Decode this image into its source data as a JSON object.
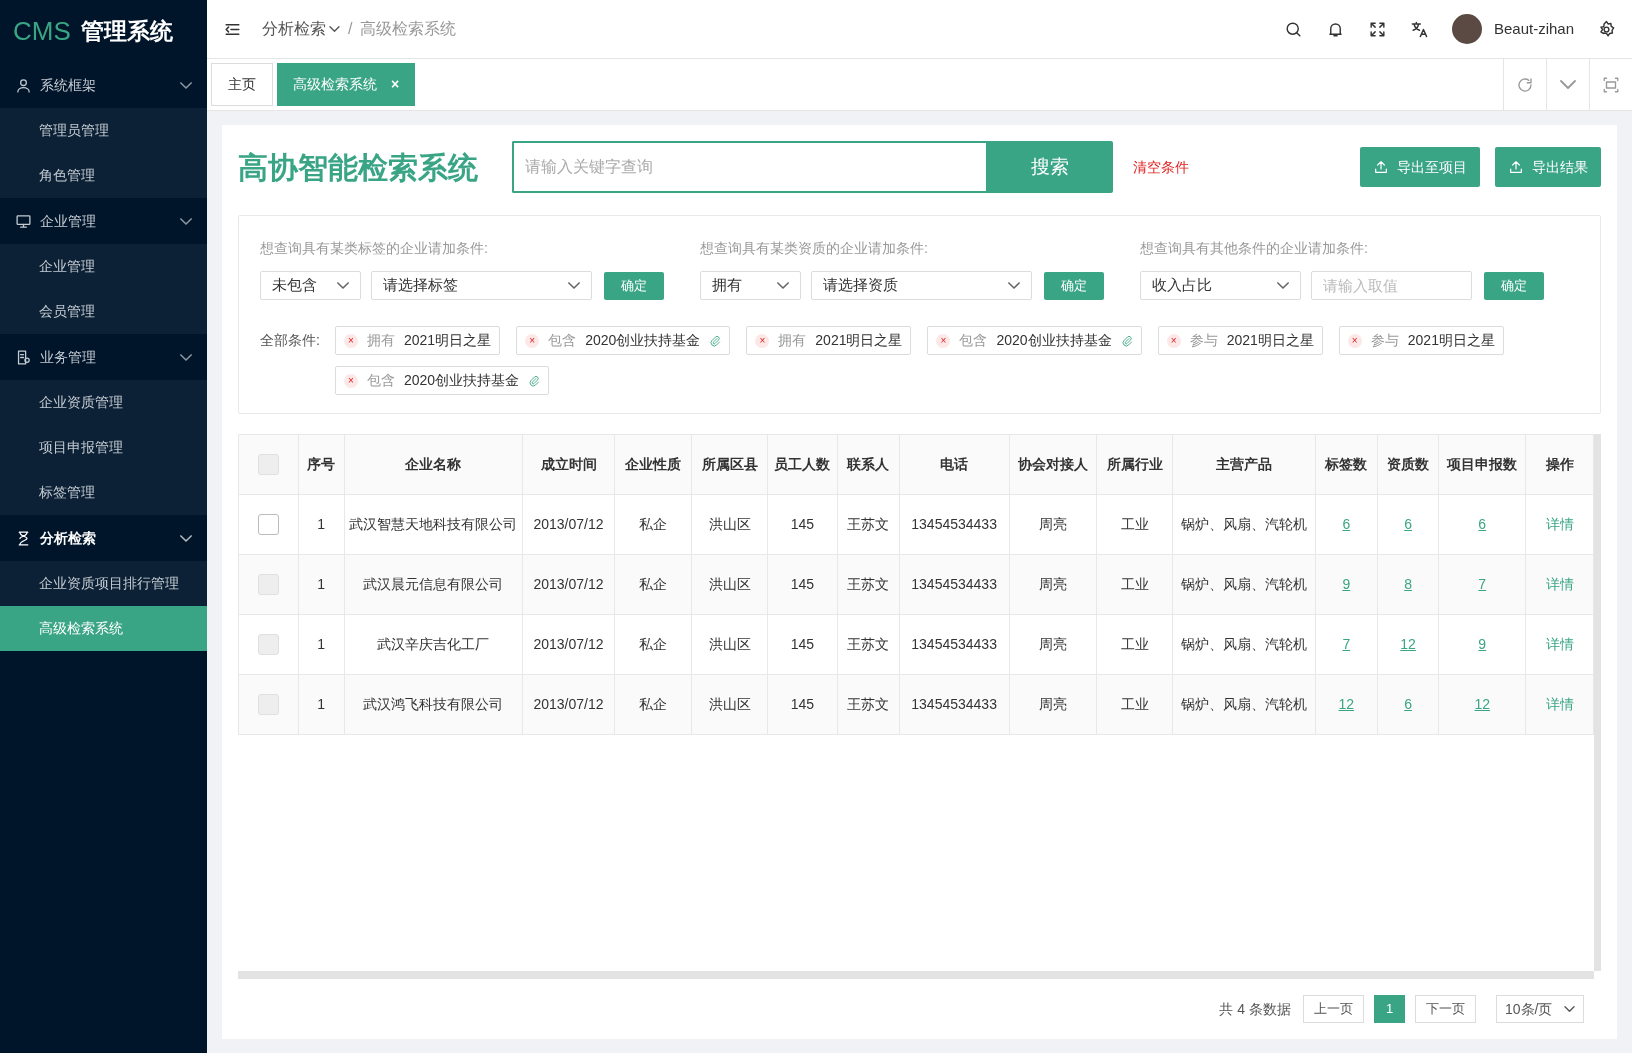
{
  "sidebar": {
    "logo_brand": "CMS",
    "logo_title": "管理系统",
    "groups": [
      {
        "label": "系统框架",
        "active": false,
        "items": [
          {
            "label": "管理员管理",
            "selected": false
          },
          {
            "label": "角色管理",
            "selected": false
          }
        ]
      },
      {
        "label": "企业管理",
        "active": false,
        "items": [
          {
            "label": "企业管理",
            "selected": false
          },
          {
            "label": "会员管理",
            "selected": false
          }
        ]
      },
      {
        "label": "业务管理",
        "active": false,
        "items": [
          {
            "label": "企业资质管理",
            "selected": false
          },
          {
            "label": "项目申报管理",
            "selected": false
          },
          {
            "label": "标签管理",
            "selected": false
          }
        ]
      },
      {
        "label": "分析检索",
        "active": true,
        "items": [
          {
            "label": "企业资质项目排行管理",
            "selected": false
          },
          {
            "label": "高级检索系统",
            "selected": true
          }
        ]
      }
    ]
  },
  "header": {
    "breadcrumb": [
      "分析检索",
      "高级检索系统"
    ],
    "separator": "/",
    "user": "Beaut-zihan"
  },
  "tabs": [
    {
      "label": "主页",
      "selected": false
    },
    {
      "label": "高级检索系统",
      "selected": true,
      "close": "×"
    }
  ],
  "search": {
    "title": "高协智能检索系统",
    "placeholder": "请输入关键字查询",
    "button": "搜索",
    "clear": "清空条件",
    "export_project": "导出至项目",
    "export_result": "导出结果"
  },
  "filters": [
    {
      "label": "想查询具有某类标签的企业请加条件:",
      "select1": "未包含",
      "select2": "请选择标签",
      "kind": "select",
      "button": "确定"
    },
    {
      "label": "想查询具有某类资质的企业请加条件:",
      "select1": "拥有",
      "select2": "请选择资质",
      "kind": "select",
      "button": "确定"
    },
    {
      "label": "想查询具有其他条件的企业请加条件:",
      "select1": "收入占比",
      "placeholder": "请输入取值",
      "kind": "input",
      "button": "确定"
    }
  ],
  "conditions_label": "全部条件:",
  "conditions": [
    {
      "remove": "×",
      "verb": "拥有",
      "value": "2021明日之星",
      "attachment": false
    },
    {
      "remove": "×",
      "verb": "包含",
      "value": "2020创业扶持基金",
      "attachment": true
    },
    {
      "remove": "×",
      "verb": "拥有",
      "value": "2021明日之星",
      "attachment": false
    },
    {
      "remove": "×",
      "verb": "包含",
      "value": "2020创业扶持基金",
      "attachment": true
    },
    {
      "remove": "×",
      "verb": "参与",
      "value": "2021明日之星",
      "attachment": false
    },
    {
      "remove": "×",
      "verb": "参与",
      "value": "2021明日之星",
      "attachment": false
    },
    {
      "remove": "×",
      "verb": "包含",
      "value": "2020创业扶持基金",
      "attachment": true
    }
  ],
  "table": {
    "select_all_disabled": true,
    "columns": [
      "序号",
      "企业名称",
      "成立时间",
      "企业性质",
      "所属区县",
      "员工人数",
      "联系人",
      "电话",
      "协会对接人",
      "所属行业",
      "主营产品",
      "标签数",
      "资质数",
      "项目申报数",
      "操作"
    ],
    "rows": [
      {
        "disabled": false,
        "cells": [
          "1",
          "武汉智慧天地科技有限公司",
          "2013/07/12",
          "私企",
          "洪山区",
          "145",
          "王苏文",
          "13454534433",
          "周亮",
          "工业",
          "锅炉、风扇、汽轮机",
          "6",
          "6",
          "6",
          "详情"
        ]
      },
      {
        "disabled": true,
        "cells": [
          "1",
          "武汉晨元信息有限公司",
          "2013/07/12",
          "私企",
          "洪山区",
          "145",
          "王苏文",
          "13454534433",
          "周亮",
          "工业",
          "锅炉、风扇、汽轮机",
          "9",
          "8",
          "7",
          "详情"
        ]
      },
      {
        "disabled": true,
        "cells": [
          "1",
          "武汉辛庆吉化工厂",
          "2013/07/12",
          "私企",
          "洪山区",
          "145",
          "王苏文",
          "13454534433",
          "周亮",
          "工业",
          "锅炉、风扇、汽轮机",
          "7",
          "12",
          "9",
          "详情"
        ]
      },
      {
        "disabled": true,
        "cells": [
          "1",
          "武汉鸿飞科技有限公司",
          "2013/07/12",
          "私企",
          "洪山区",
          "145",
          "王苏文",
          "13454534433",
          "周亮",
          "工业",
          "锅炉、风扇、汽轮机",
          "12",
          "6",
          "12",
          "详情"
        ]
      }
    ]
  },
  "pagination": {
    "total": "共 4 条数据",
    "prev": "上一页",
    "pages": [
      {
        "label": "1",
        "selected": true
      }
    ],
    "next": "下一页",
    "page_size": "10条/页"
  }
}
